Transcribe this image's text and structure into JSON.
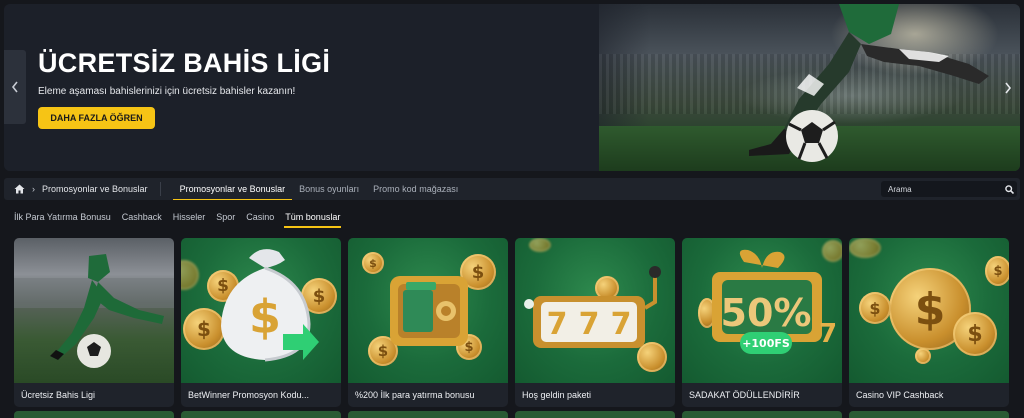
{
  "hero": {
    "title": "ÜCRETSİZ BAHİS LİGİ",
    "subtitle": "Eleme aşaması bahislerinizi için ücretsiz bahisler kazanın!",
    "cta_label": "DAHA FAZLA ÖĞREN",
    "accent_color": "#f6c415"
  },
  "breadcrumb": {
    "home_icon": "home-icon",
    "current": "Promosyonlar ve Bonuslar"
  },
  "nav_tabs": [
    {
      "label": "Promosyonlar ve Bonuslar",
      "active": true
    },
    {
      "label": "Bonus oyunları",
      "active": false
    },
    {
      "label": "Promo kod mağazası",
      "active": false
    }
  ],
  "search": {
    "placeholder": "Arama",
    "icon": "search-icon"
  },
  "filters": [
    {
      "label": "İlk Para Yatırma Bonusu",
      "active": false
    },
    {
      "label": "Cashback",
      "active": false
    },
    {
      "label": "Hisseler",
      "active": false
    },
    {
      "label": "Spor",
      "active": false
    },
    {
      "label": "Casino",
      "active": false
    },
    {
      "label": "Tüm bonuslar",
      "active": true
    }
  ],
  "cards": [
    {
      "title": "Ücretsiz Bahis Ligi",
      "image": "football-player-image"
    },
    {
      "title": "BetWinner Promosyon Kodu...",
      "image": "money-bag-image"
    },
    {
      "title": "%200 İlk para yatırma bonusu",
      "image": "safe-image"
    },
    {
      "title": "Hoş geldin paketi",
      "image": "slot-machine-image"
    },
    {
      "title": "SADAKAT ÖDÜLLENDİRİR",
      "image": "gift-50-percent-image",
      "badge_text": "+100FS",
      "percent_text": "50%"
    },
    {
      "title": "Casino VIP Cashback",
      "image": "coins-image"
    }
  ]
}
